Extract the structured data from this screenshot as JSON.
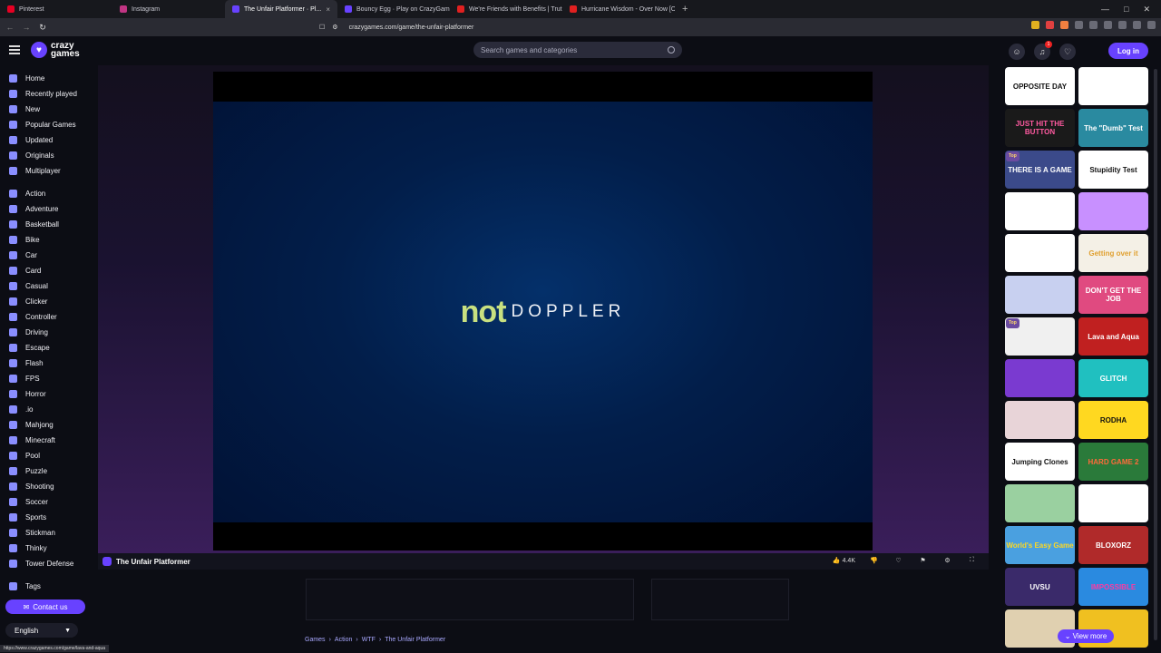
{
  "browser": {
    "tabs": [
      {
        "label": "Pinterest",
        "color": "#e60023"
      },
      {
        "label": "Instagram",
        "color": "#c13584"
      },
      {
        "label": "The Unfair Platformer · Pl...",
        "color": "#6842ff",
        "active": true
      },
      {
        "label": "Bouncy Egg · Play on CrazyGames",
        "color": "#6842ff"
      },
      {
        "label": "We're Friends with Benefits | Truth.c",
        "color": "#e02020"
      },
      {
        "label": "Hurricane Wisdom - Over Now [Offi",
        "color": "#e02020"
      }
    ],
    "url": "crazygames.com/game/the-unfair-platformer",
    "status_url": "https://www.crazygames.com/game/lava-and-aqua"
  },
  "header": {
    "logo_top": "crazy",
    "logo_bottom": "games",
    "search_placeholder": "Search games and categories",
    "login_label": "Log in",
    "notification_count": "1"
  },
  "sidebar": {
    "primary": [
      "Home",
      "Recently played",
      "New",
      "Popular Games",
      "Updated",
      "Originals",
      "Multiplayer"
    ],
    "categories": [
      "Action",
      "Adventure",
      "Basketball",
      "Bike",
      "Car",
      "Card",
      "Casual",
      "Clicker",
      "Controller",
      "Driving",
      "Escape",
      "Flash",
      "FPS",
      "Horror",
      ".io",
      "Mahjong",
      "Minecraft",
      "Pool",
      "Puzzle",
      "Shooting",
      "Soccer",
      "Sports",
      "Stickman",
      "Thinky",
      "Tower Defense"
    ],
    "tags_label": "Tags",
    "contact_label": "Contact us",
    "language": "English"
  },
  "game": {
    "splash_brand_a": "not",
    "splash_brand_b": "DOPPLER",
    "title": "The Unfair Platformer",
    "likes": "4.4K"
  },
  "breadcrumbs": [
    "Games",
    "Action",
    "WTF",
    "The Unfair Platformer"
  ],
  "side_games": [
    {
      "text": "OPPOSITE DAY",
      "bg": "#ffffff",
      "fg": "#111"
    },
    {
      "text": "",
      "bg": "#ffffff",
      "fg": "#111"
    },
    {
      "text": "JUST HIT THE BUTTON",
      "bg": "#1a1a1a",
      "fg": "#ff5aa0"
    },
    {
      "text": "The \"Dumb\" Test",
      "bg": "#2a8aa0",
      "fg": "#fff"
    },
    {
      "text": "THERE IS A GAME",
      "bg": "#3b4a8a",
      "fg": "#fff",
      "top": "Top"
    },
    {
      "text": "Stupidity Test",
      "bg": "#ffffff",
      "fg": "#111"
    },
    {
      "text": "",
      "bg": "#ffffff",
      "fg": "#111"
    },
    {
      "text": "",
      "bg": "#c890ff",
      "fg": "#fff"
    },
    {
      "text": "",
      "bg": "#ffffff",
      "fg": "#111"
    },
    {
      "text": "Getting over it",
      "bg": "#f4f0e6",
      "fg": "#e0a030"
    },
    {
      "text": "",
      "bg": "#c8d0f0",
      "fg": "#111"
    },
    {
      "text": "DON'T GET THE JOB",
      "bg": "#e04a80",
      "fg": "#fff"
    },
    {
      "text": "",
      "bg": "#f0f0f0",
      "fg": "#111",
      "top": "Top"
    },
    {
      "text": "Lava and Aqua",
      "bg": "#c02020",
      "fg": "#fff"
    },
    {
      "text": "",
      "bg": "#7a3ad0",
      "fg": "#fff"
    },
    {
      "text": "GLITCH",
      "bg": "#20c0c0",
      "fg": "#fff"
    },
    {
      "text": "",
      "bg": "#e8d4d8",
      "fg": "#111"
    },
    {
      "text": "RODHA",
      "bg": "#ffd820",
      "fg": "#111"
    },
    {
      "text": "Jumping Clones",
      "bg": "#ffffff",
      "fg": "#111"
    },
    {
      "text": "HARD GAME 2",
      "bg": "#2a7a3a",
      "fg": "#ff6a3a"
    },
    {
      "text": "",
      "bg": "#9ad0a0",
      "fg": "#fff"
    },
    {
      "text": "",
      "bg": "#ffffff",
      "fg": "#111"
    },
    {
      "text": "World's Easy Game",
      "bg": "#4aa0e0",
      "fg": "#ffd820"
    },
    {
      "text": "BLOXORZ",
      "bg": "#b02a2a",
      "fg": "#fff"
    },
    {
      "text": "UVSU",
      "bg": "#3a2a6a",
      "fg": "#fff"
    },
    {
      "text": "IMPOSSIBLE",
      "bg": "#2a8ae0",
      "fg": "#ff3aa0"
    },
    {
      "text": "",
      "bg": "#e0d0b0",
      "fg": "#111"
    },
    {
      "text": "",
      "bg": "#f0c020",
      "fg": "#111"
    }
  ],
  "view_more_label": "View more"
}
